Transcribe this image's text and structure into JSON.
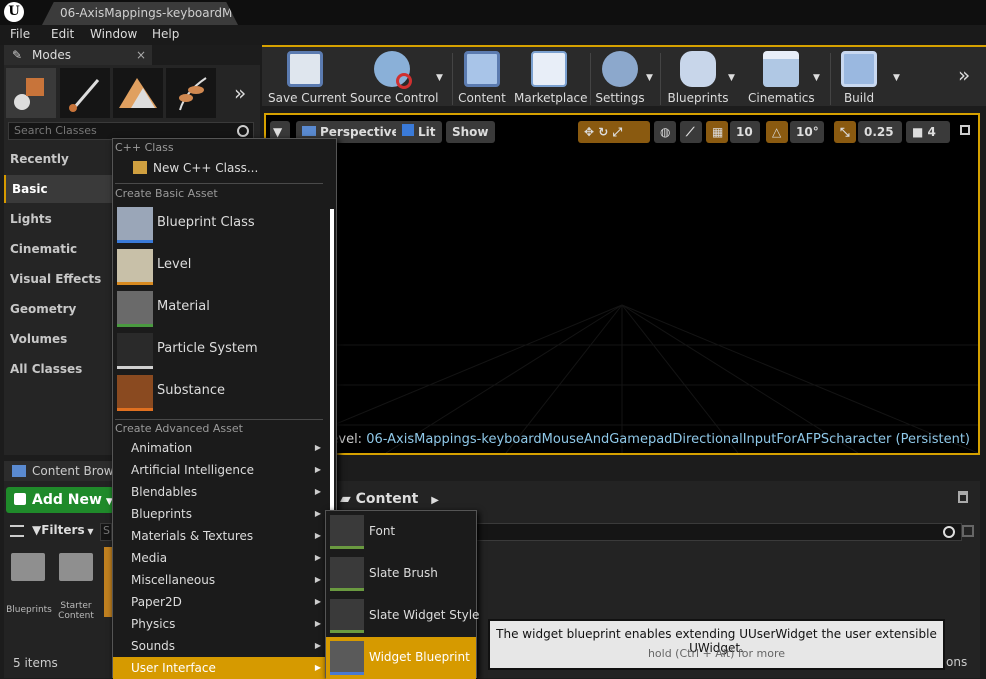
{
  "window": {
    "tab_title": "06-AxisMappings-keyboardM"
  },
  "menubar": [
    "File",
    "Edit",
    "Window",
    "Help"
  ],
  "modes": {
    "title": "Modes",
    "search_placeholder": "Search Classes",
    "categories": [
      "Recently Placed",
      "Basic",
      "Lights",
      "Cinematic",
      "Visual Effects",
      "Geometry",
      "Volumes",
      "All Classes"
    ],
    "active_category": "Basic"
  },
  "toolbar": {
    "items": [
      "Save Current",
      "Source Control",
      "Content",
      "Marketplace",
      "Settings",
      "Blueprints",
      "Cinematics",
      "Build"
    ]
  },
  "viewport": {
    "perspective": "Perspective",
    "lit": "Lit",
    "show": "Show",
    "grid_snap": "10",
    "rotation_snap": "10°",
    "scale_snap": "0.25",
    "camera_speed": "4",
    "level_label": "Level:",
    "level_name": "06-AxisMappings-keyboardMouseAndGamepadDirectionalInputForAFPScharacter (Persistent)"
  },
  "content_browser": {
    "tab": "Content Browser",
    "add_new": "Add New",
    "filters": "Filters",
    "search_initial": "S",
    "path": "Content",
    "folders": [
      "Blueprints",
      "Starter Content"
    ],
    "item_count": "5 items",
    "partial_label": "ons"
  },
  "add_new_menu": {
    "cpp_header": "C++ Class",
    "cpp_item": "New C++ Class...",
    "basic_header": "Create Basic Asset",
    "basic_items": [
      "Blueprint Class",
      "Level",
      "Material",
      "Particle System",
      "Substance"
    ],
    "advanced_header": "Create Advanced Asset",
    "advanced_items": [
      "Animation",
      "Artificial Intelligence",
      "Blendables",
      "Blueprints",
      "Materials & Textures",
      "Media",
      "Miscellaneous",
      "Paper2D",
      "Physics",
      "Sounds",
      "User Interface"
    ],
    "active_advanced": "User Interface"
  },
  "ui_submenu": {
    "items": [
      "Font",
      "Slate Brush",
      "Slate Widget Style",
      "Widget Blueprint"
    ],
    "active": "Widget Blueprint"
  },
  "tooltip": {
    "text": "The widget blueprint enables extending UUserWidget the user extensible UWidget.",
    "hint": "hold (Ctrl + Alt) for more"
  }
}
